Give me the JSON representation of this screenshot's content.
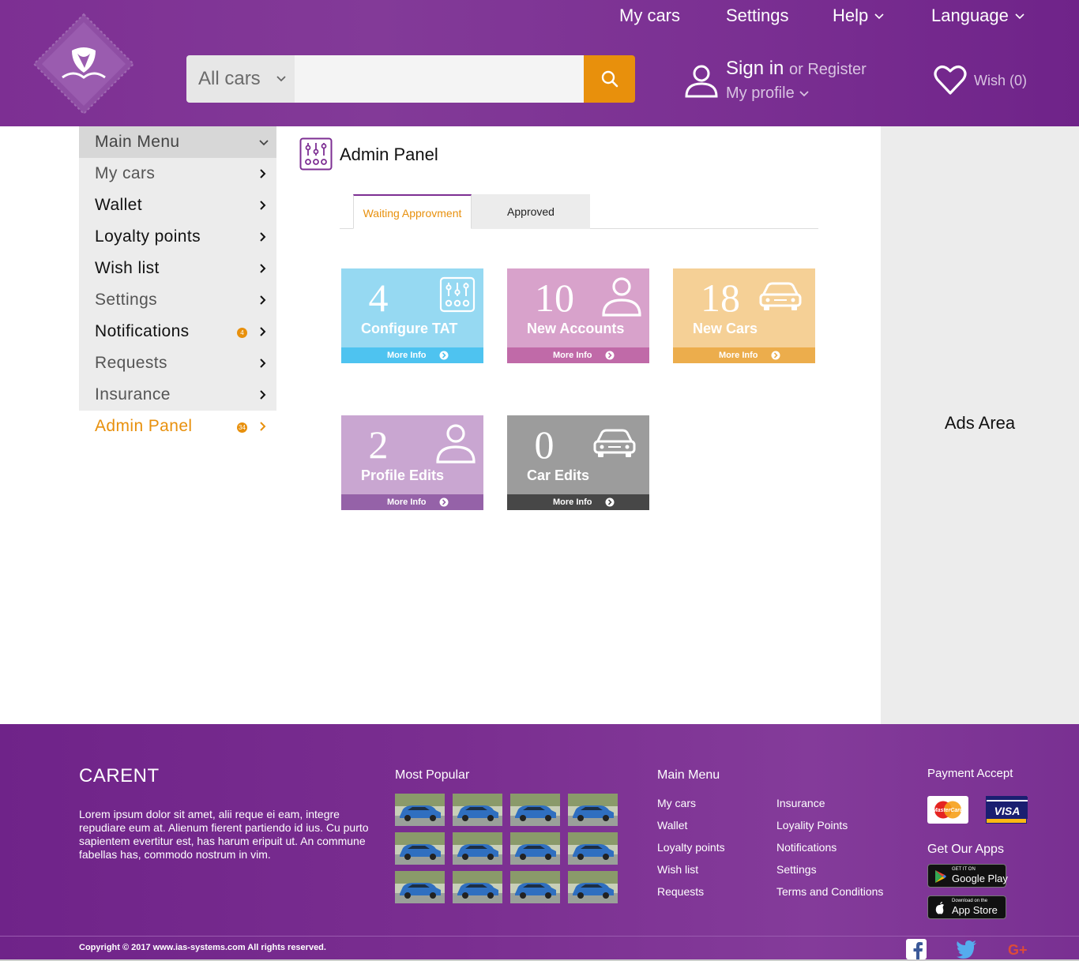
{
  "header": {
    "nav": [
      {
        "label": "My cars"
      },
      {
        "label": "Settings"
      },
      {
        "label": "Help"
      },
      {
        "label": "Language"
      }
    ],
    "search": {
      "category": "All cars",
      "placeholder": "",
      "value": ""
    },
    "signin": "Sign in",
    "or_register": "or Register",
    "my_profile": "My profile",
    "wish": "Wish (0)"
  },
  "sidebar": {
    "items": [
      {
        "label": "Main Menu",
        "icon": "chevron-down-icon"
      },
      {
        "label": "My cars",
        "icon": "chevron-right-icon"
      },
      {
        "label": "Wallet",
        "icon": "chevron-right-icon"
      },
      {
        "label": "Loyalty points",
        "icon": "chevron-right-icon"
      },
      {
        "label": "Wish list",
        "icon": "chevron-right-icon"
      },
      {
        "label": "Settings",
        "icon": "chevron-right-icon"
      },
      {
        "label": "Notifications",
        "icon": "chevron-right-icon",
        "badge": "4"
      },
      {
        "label": "Requests",
        "icon": "chevron-right-icon"
      },
      {
        "label": "Insurance",
        "icon": "chevron-right-icon"
      },
      {
        "label": "Admin Panel",
        "icon": "chevron-right-icon",
        "badge": "34"
      }
    ]
  },
  "main": {
    "title": "Admin Panel",
    "tabs": [
      {
        "label": "Waiting Approvment",
        "active": true
      },
      {
        "label": "Approved",
        "active": false
      }
    ],
    "cards": [
      {
        "value": "4",
        "label": "Configure TAT",
        "more": "More Info",
        "icon": "sliders-icon",
        "color": "#96d9f2",
        "footer_color": "#4ec3f0"
      },
      {
        "value": "10",
        "label": "New Accounts",
        "more": "More Info",
        "icon": "user-icon",
        "color": "#d8a2cb",
        "footer_color": "#c06aa8"
      },
      {
        "value": "18",
        "label": "New Cars",
        "more": "More Info",
        "icon": "car-icon",
        "color": "#f5d096",
        "footer_color": "#ecad4c"
      },
      {
        "value": "2",
        "label": "Profile Edits",
        "more": "More Info",
        "icon": "user-icon",
        "color": "#c9a6d1",
        "footer_color": "#9562a8"
      },
      {
        "value": "0",
        "label": "Car Edits",
        "more": "More Info",
        "icon": "car-icon",
        "color": "#9c9c9c",
        "footer_color": "#474747"
      }
    ]
  },
  "ads": {
    "label": "Ads Area"
  },
  "footer": {
    "brand": "CARENT",
    "about": "Lorem ipsum dolor sit amet, alii reque ei eam, integre repudiare eum at. Alienum fierent partiendo id ius. Cu purto sapientem evertitur est, has harum eripuit ut. An commune fabellas has, commodo nostrum in vim.",
    "most_popular": "Most Popular",
    "main_menu": "Main Menu",
    "links_col1": [
      "My cars",
      "Wallet",
      "Loyalty points",
      "Wish list",
      "Requests"
    ],
    "links_col2": [
      "Insurance",
      "Loyality Points",
      "Notifications",
      "Settings",
      "Terms and Conditions"
    ],
    "payment": "Payment Accept",
    "payment_cards": [
      "MasterCard",
      "VISA"
    ],
    "get_apps": "Get Our Apps",
    "google_play": {
      "small": "GET IT ON",
      "big": "Google Play"
    },
    "app_store": {
      "small": "Download on the",
      "big": "App Store"
    },
    "copyright": "Copyright © 2017 www.ias-systems.com  All rights reserved.",
    "social": [
      "facebook-icon",
      "twitter-icon",
      "google-plus-icon"
    ]
  },
  "colors": {
    "brand": "#7d2f93",
    "accent": "#e8900c"
  }
}
